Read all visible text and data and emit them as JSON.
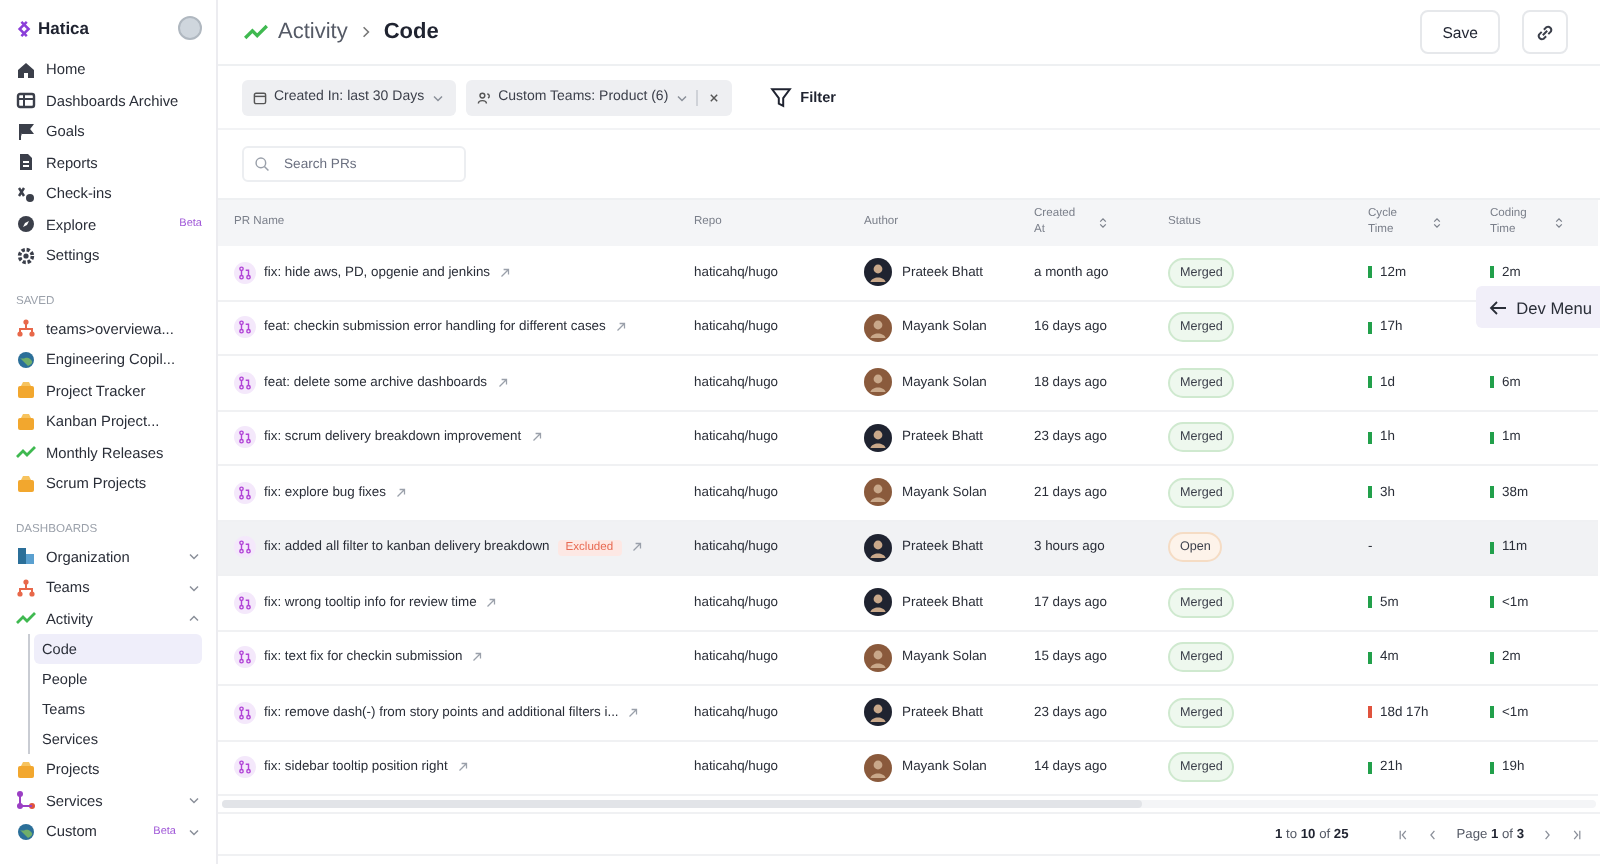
{
  "sidebar": {
    "brand": "Hatica",
    "nav": [
      {
        "label": "Home"
      },
      {
        "label": "Dashboards Archive"
      },
      {
        "label": "Goals"
      },
      {
        "label": "Reports"
      },
      {
        "label": "Check-ins"
      },
      {
        "label": "Explore",
        "badge": "Beta"
      },
      {
        "label": "Settings"
      }
    ],
    "saved_heading": "SAVED",
    "saved": [
      {
        "label": "teams>overviewa..."
      },
      {
        "label": "Engineering Copil..."
      },
      {
        "label": "Project Tracker"
      },
      {
        "label": "Kanban Project..."
      },
      {
        "label": "Monthly Releases"
      },
      {
        "label": "Scrum Projects"
      }
    ],
    "dashboards_heading": "DASHBOARDS",
    "dashboards": [
      {
        "label": "Organization",
        "expanded": false
      },
      {
        "label": "Teams",
        "expanded": false
      },
      {
        "label": "Activity",
        "expanded": true,
        "children": [
          {
            "label": "Code",
            "selected": true
          },
          {
            "label": "People",
            "selected": false
          },
          {
            "label": "Teams",
            "selected": false
          },
          {
            "label": "Services",
            "selected": false
          }
        ]
      },
      {
        "label": "Projects"
      },
      {
        "label": "Services",
        "expanded": false
      },
      {
        "label": "Custom",
        "badge": "Beta",
        "expanded": false
      }
    ]
  },
  "header": {
    "breadcrumb": [
      "Activity",
      "Code"
    ],
    "save": "Save"
  },
  "filters": [
    {
      "label": "Created In: last 30 Days",
      "removable": false
    },
    {
      "label": "Custom Teams: Product (6)",
      "removable": true
    }
  ],
  "filter_button": "Filter",
  "search": {
    "placeholder": "Search PRs"
  },
  "table": {
    "columns": [
      {
        "label": "PR Name",
        "sortable": false
      },
      {
        "label": "Repo",
        "sortable": false
      },
      {
        "label": "Author",
        "sortable": false
      },
      {
        "label": "Created At",
        "sortable": true
      },
      {
        "label": "Status",
        "sortable": false
      },
      {
        "label": "Cycle Time",
        "sortable": true
      },
      {
        "label": "Coding Time",
        "sortable": true
      }
    ],
    "rows": [
      {
        "pr": "fix: hide aws, PD, opgenie and jenkins",
        "repo": "haticahq/hugo",
        "author": {
          "name": "Prateek Bhatt",
          "color": "#1f2330"
        },
        "created": "a month ago",
        "status": {
          "label": "Merged",
          "kind": "merged"
        },
        "cycle": {
          "text": "12m",
          "color": "#22a04b"
        },
        "coding": {
          "text": "2m",
          "color": "#22a04b"
        },
        "selected": false
      },
      {
        "pr": "feat: checkin submission error handling for different cases",
        "repo": "haticahq/hugo",
        "author": {
          "name": "Mayank Solan",
          "color": "#8a5a3c"
        },
        "created": "16 days ago",
        "status": {
          "label": "Merged",
          "kind": "merged"
        },
        "cycle": {
          "text": "17h",
          "color": "#22a04b"
        },
        "selected": false
      },
      {
        "pr": "feat: delete some archive dashboards",
        "repo": "haticahq/hugo",
        "author": {
          "name": "Mayank Solan",
          "color": "#8a5a3c"
        },
        "created": "18 days ago",
        "status": {
          "label": "Merged",
          "kind": "merged"
        },
        "cycle": {
          "text": "1d",
          "color": "#22a04b"
        },
        "coding": {
          "text": "6m",
          "color": "#22a04b"
        },
        "selected": false
      },
      {
        "pr": "fix: scrum delivery breakdown improvement",
        "repo": "haticahq/hugo",
        "author": {
          "name": "Prateek Bhatt",
          "color": "#1f2330"
        },
        "created": "23 days ago",
        "status": {
          "label": "Merged",
          "kind": "merged"
        },
        "cycle": {
          "text": "1h",
          "color": "#22a04b"
        },
        "coding": {
          "text": "1m",
          "color": "#22a04b"
        },
        "selected": false
      },
      {
        "pr": "fix: explore bug fixes",
        "repo": "haticahq/hugo",
        "author": {
          "name": "Mayank Solan",
          "color": "#8a5a3c"
        },
        "created": "21 days ago",
        "status": {
          "label": "Merged",
          "kind": "merged"
        },
        "cycle": {
          "text": "3h",
          "color": "#22a04b"
        },
        "coding": {
          "text": "38m",
          "color": "#22a04b"
        },
        "selected": false
      },
      {
        "pr": "fix: added all filter to kanban delivery breakdown",
        "badge": "Excluded",
        "repo": "haticahq/hugo",
        "author": {
          "name": "Prateek Bhatt",
          "color": "#1f2330"
        },
        "created": "3 hours ago",
        "status": {
          "label": "Open",
          "kind": "open"
        },
        "cycle": {
          "text": "-"
        },
        "coding": {
          "text": "11m",
          "color": "#22a04b"
        },
        "selected": true
      },
      {
        "pr": "fix: wrong tooltip info for review time",
        "repo": "haticahq/hugo",
        "author": {
          "name": "Prateek Bhatt",
          "color": "#1f2330"
        },
        "created": "17 days ago",
        "status": {
          "label": "Merged",
          "kind": "merged"
        },
        "cycle": {
          "text": "5m",
          "color": "#22a04b"
        },
        "coding": {
          "text": "<1m",
          "color": "#22a04b"
        },
        "selected": false
      },
      {
        "pr": "fix: text fix for checkin submission",
        "repo": "haticahq/hugo",
        "author": {
          "name": "Mayank Solan",
          "color": "#8a5a3c"
        },
        "created": "15 days ago",
        "status": {
          "label": "Merged",
          "kind": "merged"
        },
        "cycle": {
          "text": "4m",
          "color": "#22a04b"
        },
        "coding": {
          "text": "2m",
          "color": "#22a04b"
        },
        "selected": false
      },
      {
        "pr": "fix: remove dash(-) from story points and additional filters i...",
        "repo": "haticahq/hugo",
        "author": {
          "name": "Prateek Bhatt",
          "color": "#1f2330"
        },
        "created": "23 days ago",
        "status": {
          "label": "Merged",
          "kind": "merged"
        },
        "cycle": {
          "text": "18d 17h",
          "color": "#e0533d"
        },
        "coding": {
          "text": "<1m",
          "color": "#22a04b"
        },
        "selected": false
      },
      {
        "pr": "fix: sidebar tooltip position right",
        "repo": "haticahq/hugo",
        "author": {
          "name": "Mayank Solan",
          "color": "#8a5a3c"
        },
        "created": "14 days ago",
        "status": {
          "label": "Merged",
          "kind": "merged"
        },
        "cycle": {
          "text": "21h",
          "color": "#22a04b"
        },
        "coding": {
          "text": "19h",
          "color": "#22a04b"
        },
        "selected": false
      }
    ]
  },
  "pagination": {
    "range": "**1** to **10** of **25**",
    "page": "Page **1** of **3**"
  },
  "dev_menu": "Dev Menu"
}
